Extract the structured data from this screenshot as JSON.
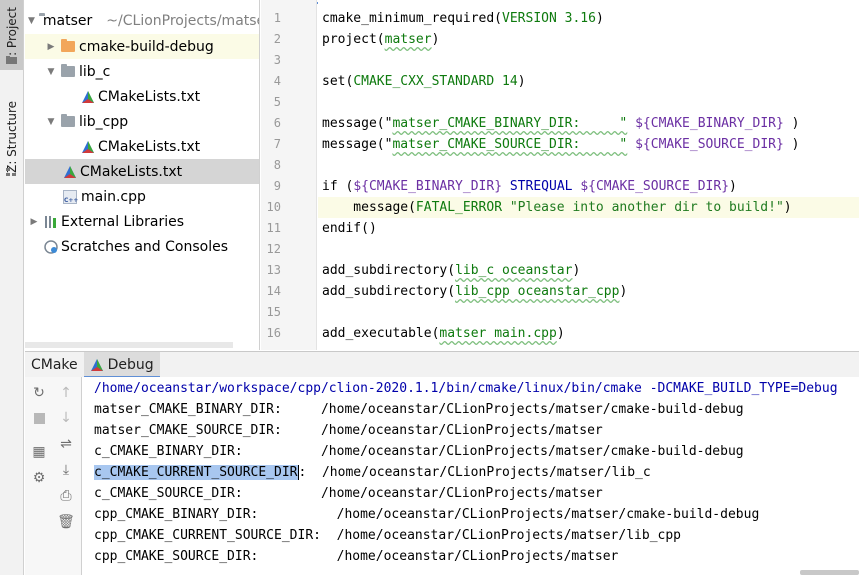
{
  "tool_strip": {
    "project_label": "1: Project",
    "structure_label": "Z: Structure"
  },
  "project_tree": {
    "root_name": "matser",
    "root_path": "~/CLionProjects/matser",
    "items": [
      {
        "label": "cmake-build-debug"
      },
      {
        "label": "lib_c"
      },
      {
        "label": "CMakeLists.txt"
      },
      {
        "label": "lib_cpp"
      },
      {
        "label": "CMakeLists.txt"
      },
      {
        "label": "CMakeLists.txt"
      },
      {
        "label": "main.cpp"
      },
      {
        "label": "External Libraries"
      },
      {
        "label": "Scratches and Consoles"
      }
    ]
  },
  "editor": {
    "line_numbers": [
      "1",
      "2",
      "3",
      "4",
      "5",
      "6",
      "7",
      "8",
      "9",
      "10",
      "11",
      "12",
      "13",
      "14",
      "15",
      "16"
    ],
    "lines": [
      {
        "fn": "cmake_minimum_required(",
        "arg": "VERSION 3.16",
        "tail": ")"
      },
      {
        "fn": "project(",
        "arg": "matser",
        "tail": ")"
      },
      {
        "fn": "",
        "arg": "",
        "tail": ""
      },
      {
        "fn": "set(",
        "arg": "CMAKE_CXX_STANDARD 14",
        "tail": ")"
      },
      {
        "fn": "",
        "arg": "",
        "tail": ""
      },
      {
        "fn": "message(\"",
        "arg": "matser_CMAKE_BINARY_DIR:     \"",
        "var": " ${CMAKE_BINARY_DIR}",
        "tail": " )"
      },
      {
        "fn": "message(\"",
        "arg": "matser_CMAKE_SOURCE_DIR:     \"",
        "var": " ${CMAKE_SOURCE_DIR}",
        "tail": " )"
      },
      {
        "fn": "",
        "arg": "",
        "tail": ""
      },
      {
        "fn": "if (",
        "var": "${CMAKE_BINARY_DIR}",
        "arg": " STREQUAL ",
        "var2": "${CMAKE_SOURCE_DIR}",
        "tail": ")"
      },
      {
        "fn": "    message(",
        "arg": "FATAL_ERROR ",
        "str": "\"Please into another dir to build!\"",
        "tail": ")"
      },
      {
        "fn": "endif()",
        "arg": "",
        "tail": ""
      },
      {
        "fn": "",
        "arg": "",
        "tail": ""
      },
      {
        "fn": "add_subdirectory(",
        "arg": "lib_c oceanstar",
        "tail": ")"
      },
      {
        "fn": "add_subdirectory(",
        "arg": "lib_cpp oceanstar_cpp",
        "tail": ")"
      },
      {
        "fn": "",
        "arg": "",
        "tail": ""
      },
      {
        "fn": "add_executable(",
        "arg": "matser main.cpp",
        "tail": ")"
      }
    ]
  },
  "bottom_panel": {
    "tabs": [
      {
        "label": "CMake"
      },
      {
        "label": "Debug"
      }
    ],
    "console_lines": [
      "/home/oceanstar/workspace/cpp/clion-2020.1.1/bin/cmake/linux/bin/cmake -DCMAKE_BUILD_TYPE=Debug",
      "matser_CMAKE_BINARY_DIR:     /home/oceanstar/CLionProjects/matser/cmake-build-debug",
      "matser_CMAKE_SOURCE_DIR:     /home/oceanstar/CLionProjects/matser",
      "c_CMAKE_BINARY_DIR:          /home/oceanstar/CLionProjects/matser/cmake-build-debug",
      "c_CMAKE_SOURCE_DIR:          /home/oceanstar/CLionProjects/matser",
      "cpp_CMAKE_BINARY_DIR:          /home/oceanstar/CLionProjects/matser/cmake-build-debug",
      "cpp_CMAKE_CURRENT_SOURCE_DIR:  /home/oceanstar/CLionProjects/matser/lib_cpp",
      "cpp_CMAKE_SOURCE_DIR:          /home/oceanstar/CLionProjects/matser"
    ],
    "selected_line": {
      "selected_text": "c_CMAKE_CURRENT_SOURCE_DIR",
      "rest": ":  /home/oceanstar/CLionProjects/matser/lib_c"
    }
  },
  "colors": {
    "selection": "#a8c7f0",
    "current_line": "#fbfbe6",
    "accent": "#5f8fd6"
  }
}
